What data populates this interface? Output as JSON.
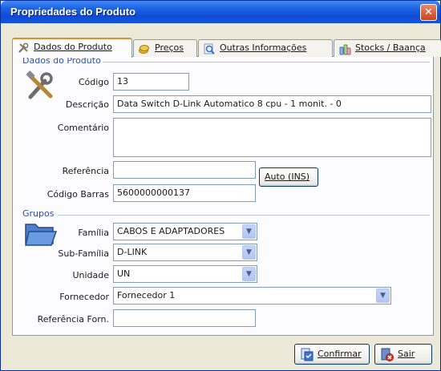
{
  "window": {
    "title": "Propriedades do Produto",
    "close_glyph": "✕"
  },
  "tabs": [
    {
      "label": "Dados do Produto",
      "icon": "tools-icon",
      "active": true
    },
    {
      "label": "Preços",
      "icon": "coins-icon",
      "active": false
    },
    {
      "label": "Outras Informações",
      "icon": "magnifier-icon",
      "active": false
    },
    {
      "label": "Stocks / Baança",
      "icon": "bottles-icon",
      "active": false
    }
  ],
  "produto": {
    "group_label": "Dados do Produto",
    "codigo_label": "Código",
    "codigo_value": "13",
    "descricao_label": "Descrição",
    "descricao_value": "Data Switch D-Link Automatico 8 cpu - 1 monit. - 0",
    "comentario_label": "Comentário",
    "comentario_value": "",
    "referencia_label": "Referência",
    "referencia_value": "",
    "auto_button": "Auto (INS)",
    "codigo_barras_label": "Código Barras",
    "codigo_barras_value": "5600000000137"
  },
  "grupos": {
    "group_label": "Grupos",
    "familia_label": "Família",
    "familia_value": "CABOS E ADAPTADORES",
    "subfamilia_label": "Sub-Família",
    "subfamilia_value": "D-LINK",
    "unidade_label": "Unidade",
    "unidade_value": "UN",
    "fornecedor_label": "Fornecedor",
    "fornecedor_value": "Fornecedor 1",
    "referencia_forn_label": "Referência Forn.",
    "referencia_forn_value": ""
  },
  "buttons": {
    "confirmar": "Confirmar",
    "sair": "Sair"
  },
  "colors": {
    "titlebar": "#0f4bd6",
    "group_label": "#2a4fb6",
    "active_tab_accent": "#e68b2c"
  }
}
